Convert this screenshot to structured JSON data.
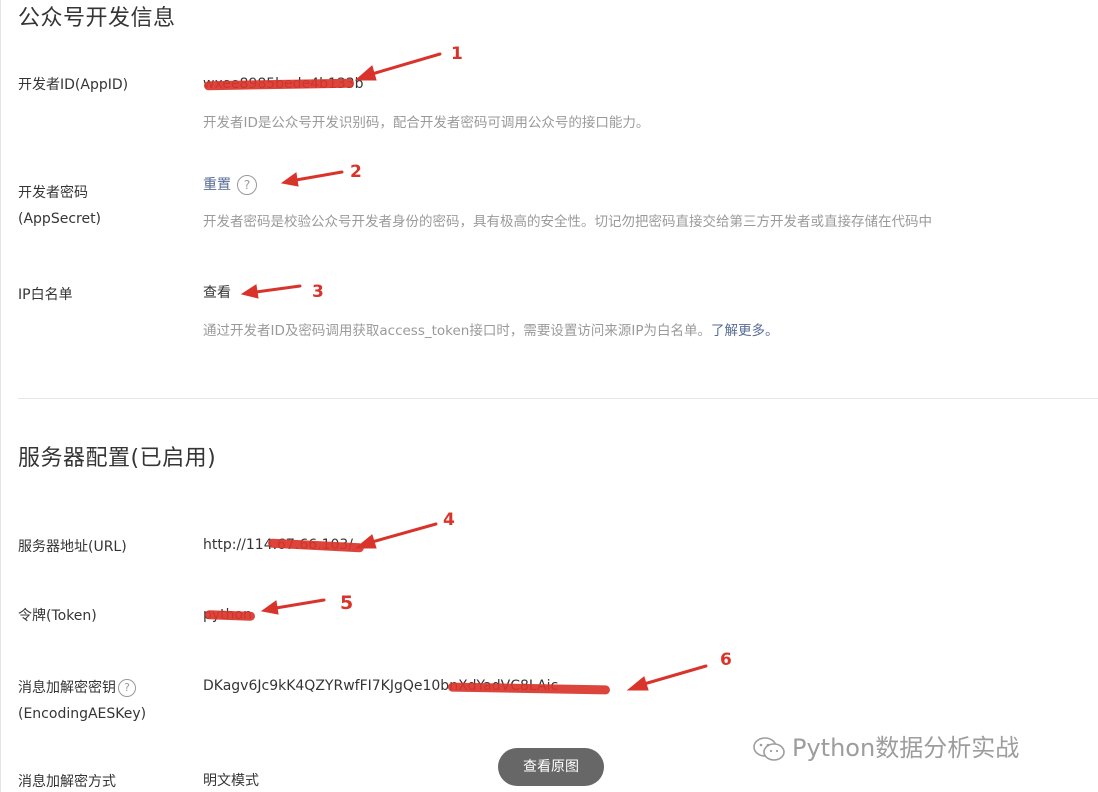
{
  "section1": {
    "title": "公众号开发信息",
    "appid": {
      "label": "开发者ID(AppID)",
      "value": "wxee8985bede4b133b",
      "desc": "开发者ID是公众号开发识别码，配合开发者密码可调用公众号的接口能力。"
    },
    "secret": {
      "label_line1": "开发者密码",
      "label_line2": "(AppSecret)",
      "action": "重置",
      "help": "?",
      "desc": "开发者密码是校验公众号开发者身份的密码，具有极高的安全性。切记勿把密码直接交给第三方开发者或直接存储在代码中"
    },
    "ip": {
      "label": "IP白名单",
      "action": "查看",
      "desc_prefix": "通过开发者ID及密码调用获取access_token接口时，需要设置访问来源IP为白名单。",
      "desc_link": "了解更多。"
    }
  },
  "section2": {
    "title": "服务器配置(已启用)",
    "url": {
      "label": "服务器地址(URL)",
      "value": "http://114.67.66.103/"
    },
    "token": {
      "label": "令牌(Token)",
      "value": "python"
    },
    "aes": {
      "label_line1": "消息加解密密钥",
      "label_line2": "(EncodingAESKey)",
      "help": "?",
      "value": "DKagv6Jc9kK4QZYRwfFI7KJgQe10bnXdYadVC8LAic"
    },
    "mode": {
      "label": "消息加解密方式",
      "value": "明文模式"
    }
  },
  "annotations": [
    "1",
    "2",
    "3",
    "4",
    "5",
    "6"
  ],
  "overlay": {
    "view_original": "查看原图",
    "watermark": "Python数据分析实战"
  },
  "colors": {
    "annotation_red": "#d9342b",
    "link_blue": "#576b95",
    "muted_text": "#9a9a9a"
  }
}
